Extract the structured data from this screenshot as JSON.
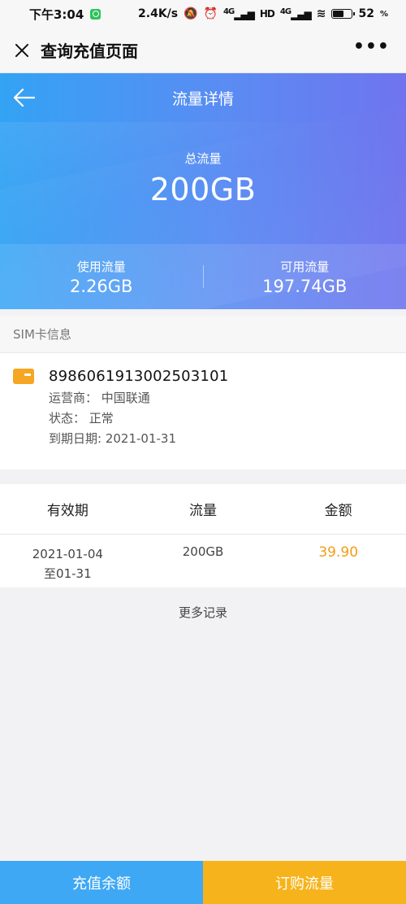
{
  "status_bar": {
    "time": "下午3:04",
    "speed": "2.4K/s",
    "network1": "4G",
    "hd": "HD",
    "network2": "4G",
    "battery": "52"
  },
  "titlebar": {
    "title": "查询充值页面",
    "more": "•••"
  },
  "hero": {
    "title": "流量详情",
    "total_label": "总流量",
    "total_value": "200GB",
    "used_label": "使用流量",
    "used_value": "2.26GB",
    "available_label": "可用流量",
    "available_value": "197.74GB"
  },
  "sim": {
    "section_title": "SIM卡信息",
    "number": "8986061913002503101",
    "carrier": "运营商：  中国联通",
    "status": "状态：  正常",
    "expiry": "到期日期: 2021-01-31"
  },
  "records": {
    "headers": [
      "有效期",
      "流量",
      "金额"
    ],
    "rows": [
      {
        "date_start": "2021-01-04",
        "date_end": "至01-31",
        "traffic": "200GB",
        "amount": "39.90"
      }
    ],
    "more": "更多记录"
  },
  "bottom": {
    "recharge": "充值余额",
    "order": "订购流量"
  },
  "colors": {
    "accent_blue": "#3fa8f4",
    "accent_orange": "#f7b31b",
    "amount": "#f29d14"
  },
  "icons": [
    "close-icon",
    "more-icon",
    "back-arrow-icon",
    "sim-card-icon"
  ]
}
